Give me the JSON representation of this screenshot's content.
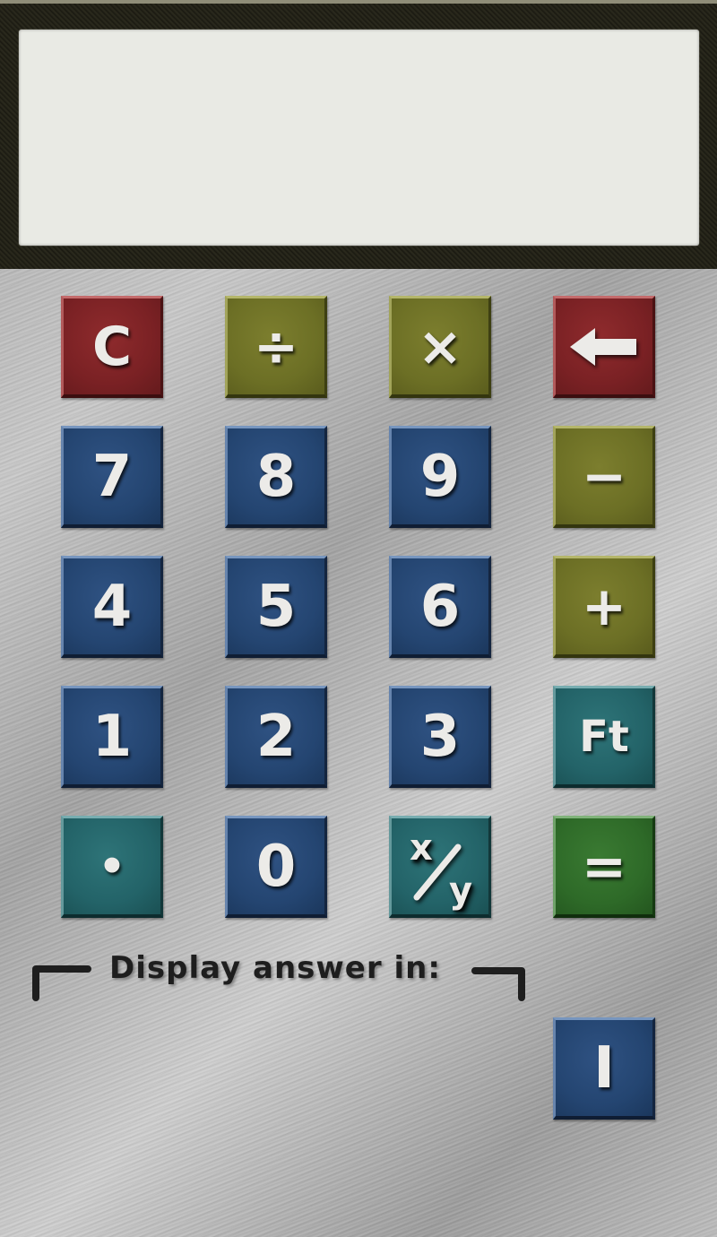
{
  "display": {
    "value": ""
  },
  "keys": {
    "clear": "C",
    "divide": "÷",
    "multiply": "×",
    "backspace_icon": "left-arrow-icon",
    "seven": "7",
    "eight": "8",
    "nine": "9",
    "minus": "−",
    "four": "4",
    "five": "5",
    "six": "6",
    "plus": "+",
    "one": "1",
    "two": "2",
    "three": "3",
    "feet": "Ft",
    "decimal": "•",
    "zero": "0",
    "fraction_numerator": "x",
    "fraction_denominator": "y",
    "equals": "=",
    "inches": "I"
  },
  "answer_unit": {
    "label": "Display answer in:"
  },
  "colors": {
    "red": "#7a2124",
    "olive": "#6c6f25",
    "blue": "#244571",
    "teal": "#236368",
    "green": "#2e6a28",
    "display": "#e9eae4",
    "frame": "#232217"
  }
}
